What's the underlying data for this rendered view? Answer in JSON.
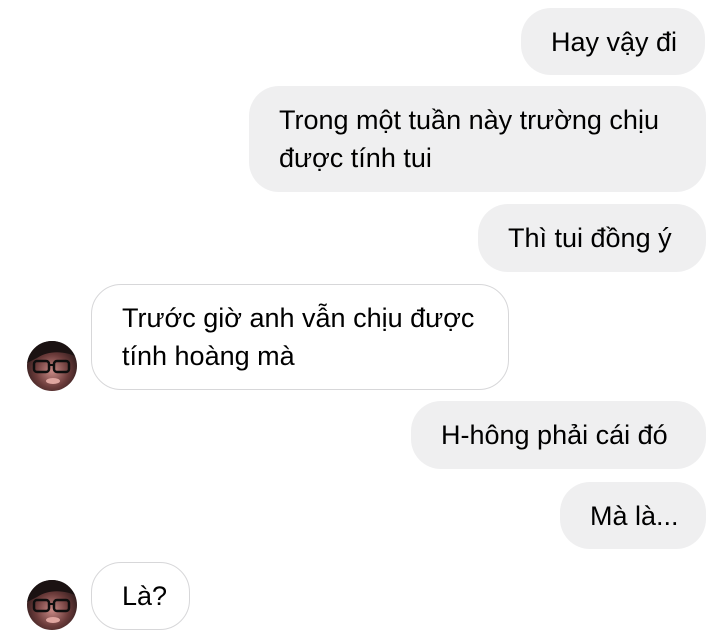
{
  "conversation": {
    "messages": [
      {
        "sender": "me",
        "text": "Hay vậy đi"
      },
      {
        "sender": "me",
        "text": "Trong một tuần này trường chịu\nđược tính tui"
      },
      {
        "sender": "me",
        "text": "Thì tui đồng ý"
      },
      {
        "sender": "other",
        "text": "Trước giờ anh vẫn chịu được\ntính hoàng mà"
      },
      {
        "sender": "me",
        "text": "H-hông phải cái đó"
      },
      {
        "sender": "me",
        "text": "Mà là..."
      },
      {
        "sender": "other",
        "text": "Là?"
      }
    ]
  },
  "colors": {
    "sent_bubble": "#efeff0",
    "received_border": "#d7d7d9",
    "background": "#ffffff"
  },
  "icons": {
    "contact_avatar": "avatar-photo"
  }
}
